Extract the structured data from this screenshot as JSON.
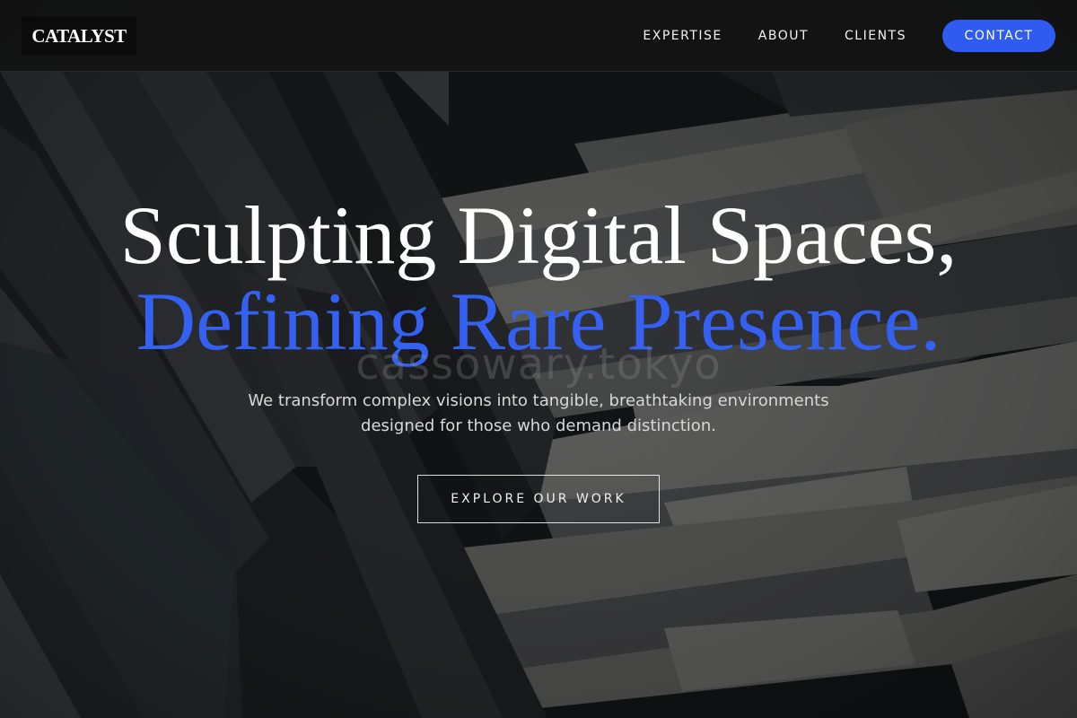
{
  "header": {
    "logo_text": "CATALYST",
    "nav": [
      {
        "label": "EXPERTISE"
      },
      {
        "label": "ABOUT"
      },
      {
        "label": "CLIENTS"
      }
    ],
    "contact_label": "CONTACT"
  },
  "hero": {
    "headline_line1": "Sculpting Digital Spaces,",
    "headline_line2": "Defining Rare Presence.",
    "watermark": "cassowary.tokyo",
    "subtitle_line1": "We transform complex visions into tangible, breathtaking environments",
    "subtitle_line2": "designed for those who demand distinction.",
    "cta_label": "EXPLORE OUR WORK"
  },
  "colors": {
    "accent": "#2f5bf0",
    "headline_accent": "#3561f2",
    "header_bg": "#141414"
  }
}
